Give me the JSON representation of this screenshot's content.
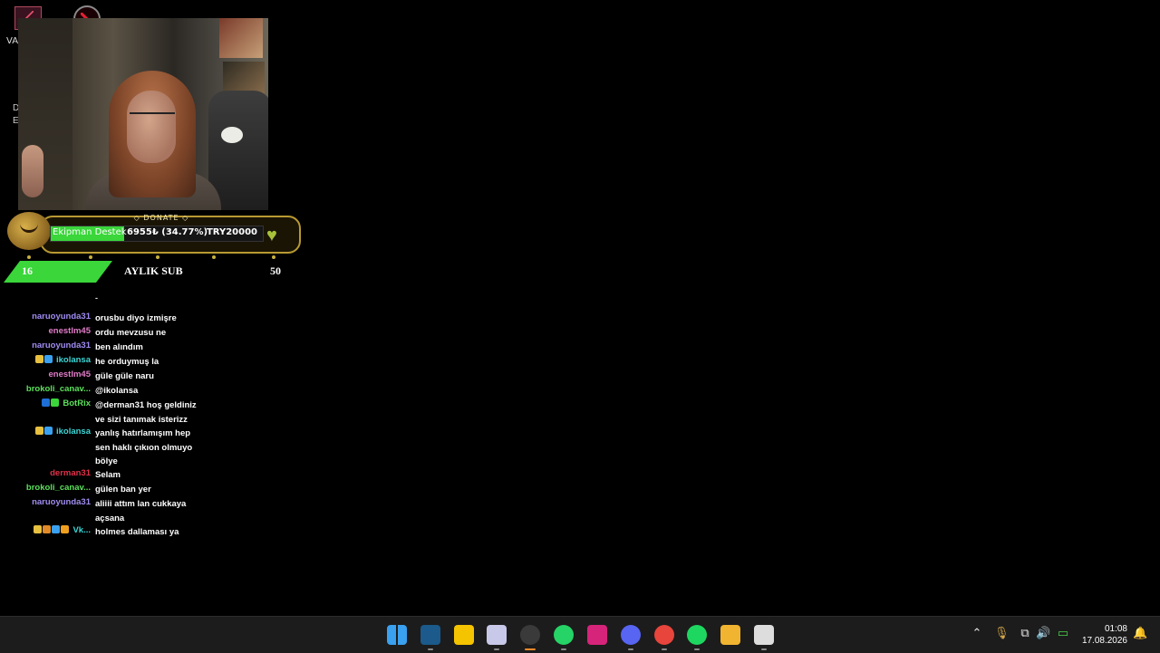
{
  "desktop": {
    "va_label": "VA",
    "frag_d": "D",
    "frag_e": "E"
  },
  "donate": {
    "header": "DONATE",
    "bar_name": "Ekipman Destek",
    "amount_text": "6955₺ (34.77%)",
    "goal_text": "TRY20000",
    "progress_percent": 34.77
  },
  "subbar": {
    "current": "16",
    "title": "AYLIK SUB",
    "goal": "50"
  },
  "chat": {
    "messages": [
      {
        "user": "naruoyunda31",
        "color": "#a08cf0",
        "badges": [],
        "text": "orusbu diyo izmişre"
      },
      {
        "user": "enestlm45",
        "color": "#e07dc8",
        "badges": [],
        "text": "ordu mevzusu ne"
      },
      {
        "user": "naruoyunda31",
        "color": "#a08cf0",
        "badges": [],
        "text": "ben alındım"
      },
      {
        "user": "ikolansa",
        "color": "#3cd6d6",
        "badges": [
          "crown",
          "sub-blue"
        ],
        "text": "he orduymuş la"
      },
      {
        "user": "enestlm45",
        "color": "#e07dc8",
        "badges": [],
        "text": "güle güle naru"
      },
      {
        "user": "brokoli_canav...",
        "color": "#5be05b",
        "badges": [],
        "text": "@ikolansa"
      },
      {
        "user": "BotRix",
        "color": "#5be05b",
        "badges": [
          "mod-blue",
          "bot-green"
        ],
        "text": "@derman31 hoş geldiniz ve sizi tanımak isterizz"
      },
      {
        "user": "ikolansa",
        "color": "#3cd6d6",
        "badges": [
          "crown",
          "sub-blue"
        ],
        "text": "yanlış hatırlamışım hep sen haklı çıkıon olmuyo bölye"
      },
      {
        "user": "derman31",
        "color": "#e0304a",
        "badges": [],
        "text": "Selam"
      },
      {
        "user": "brokoli_canav...",
        "color": "#5be05b",
        "badges": [],
        "text": "gülen ban yer"
      },
      {
        "user": "naruoyunda31",
        "color": "#a08cf0",
        "badges": [],
        "text": "aliiii attım lan cukkaya açsana"
      },
      {
        "user": "Vk...",
        "color": "#3cd6d6",
        "badges": [
          "crown",
          "gift",
          "sub-blue",
          "og"
        ],
        "text": "holmes dallaması ya"
      }
    ]
  },
  "taskbar": {
    "apps": [
      {
        "name": "windows-start",
        "color": "#3aa0f0"
      },
      {
        "name": "steam",
        "color": "#1b5a8a"
      },
      {
        "name": "sticky-notes",
        "color": "#f5c400"
      },
      {
        "name": "snipping-tool",
        "color": "#c8c8e8"
      },
      {
        "name": "obs",
        "color": "#3a3a3a"
      },
      {
        "name": "whatsapp",
        "color": "#25d366"
      },
      {
        "name": "instagram",
        "color": "#d6247a"
      },
      {
        "name": "discord",
        "color": "#5865f2"
      },
      {
        "name": "chrome",
        "color": "#e8453c"
      },
      {
        "name": "spotify",
        "color": "#1ed760"
      },
      {
        "name": "file-explorer",
        "color": "#f0b430"
      },
      {
        "name": "streamer-app",
        "color": "#dddddd"
      }
    ],
    "time": "01:08",
    "date": "17.08.2026"
  }
}
